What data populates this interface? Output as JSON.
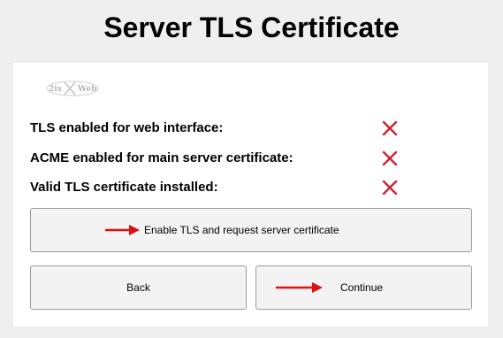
{
  "page": {
    "title": "Server TLS Certificate"
  },
  "logo": {
    "name": "2ix-web-logo-icon",
    "text": "2ix Web"
  },
  "status": {
    "rows": [
      {
        "label": "TLS enabled for web interface:",
        "value": "disabled",
        "icon": "red-x-icon"
      },
      {
        "label": "ACME enabled for main server certificate:",
        "value": "disabled",
        "icon": "red-x-icon"
      },
      {
        "label": "Valid TLS certificate installed:",
        "value": "disabled",
        "icon": "red-x-icon"
      }
    ]
  },
  "actions": {
    "enable_tls_label": "Enable TLS and request server certificate",
    "back_label": "Back",
    "continue_label": "Continue"
  },
  "colors": {
    "background": "#efefef",
    "panel": "#ffffff",
    "status_fail": "#cc2233",
    "annotation_arrow": "#dd1111",
    "button_bg": "#f3f3f3",
    "button_border": "#9b9b9b"
  }
}
